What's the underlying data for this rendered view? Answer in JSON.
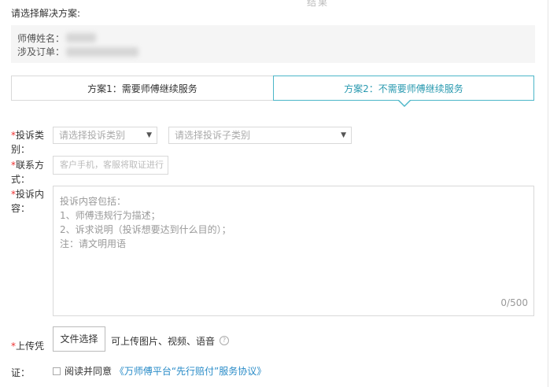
{
  "top_cut_text": "结果",
  "prompt": "请选择解决方案:",
  "info": {
    "master_name_label": "师傅姓名：",
    "order_label": "涉及订单："
  },
  "tabs": [
    {
      "label": "方案1：需要师傅继续服务",
      "active": false
    },
    {
      "label": "方案2：不需要师傅继续服务",
      "active": true
    }
  ],
  "form": {
    "required_mark": "*",
    "complaint_type": {
      "label_line1": "投诉类",
      "label_line2": "别：",
      "select1_placeholder": "请选择投诉类别",
      "select2_placeholder": "请选择投诉子类别"
    },
    "contact": {
      "label_line1": "联系方",
      "label_line2": "式：",
      "placeholder": "客户手机，客服将取证进行"
    },
    "content": {
      "label_line1": "投诉内",
      "label_line2": "容：",
      "placeholder_lines": [
        "投诉内容包括：",
        "1、师傅违规行为描述；",
        "2、诉求说明（投诉想要达到什么目的）；",
        "注：请文明用语"
      ],
      "counter": "0/500"
    },
    "upload": {
      "label_line1": "上传凭",
      "label_line2": "证：",
      "button": "文件选择",
      "hint": "可上传图片、视频、语音"
    },
    "agreement": {
      "prefix": "阅读并同意",
      "link": "《万师傅平台“先行赔付”服务协议》"
    }
  },
  "colors": {
    "accent": "#4bb6c8",
    "required": "#ee3333",
    "link": "#2a8cc8"
  }
}
